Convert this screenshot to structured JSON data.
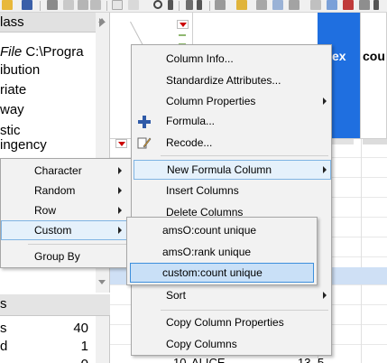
{
  "colors": {
    "accent": "#0078d7",
    "header_blue": "#1f6fe0",
    "menu_bg": "#f2f2f2",
    "highlight": "#e5f1fb",
    "highlight_strong": "#c9e0f7",
    "selected_row": "#cfe0f5",
    "red_triangle": "#cc0000"
  },
  "left_panel": {
    "header": "lass",
    "file_label": "File",
    "file_path": "C:\\Progra",
    "items": [
      "ibution",
      "riate",
      "way",
      "stic",
      "ingency"
    ]
  },
  "left_bottom": {
    "header": "s",
    "rows": [
      {
        "label": "s",
        "value": "40"
      },
      {
        "label": "d",
        "value": "1"
      },
      {
        "label": "",
        "value": "0"
      }
    ]
  },
  "grid": {
    "col_header_ex": "ex",
    "col_header_cou": "cou",
    "bottom_row_num": "10",
    "bottom_row_name": "ALICE",
    "bottom_row_val": "13",
    "bottom_row_val2": "5"
  },
  "context_menu": {
    "items": [
      {
        "label": "Column Info...",
        "icon": "",
        "submenu": false
      },
      {
        "label": "Standardize Attributes...",
        "icon": "",
        "submenu": false
      },
      {
        "label": "Column Properties",
        "icon": "",
        "submenu": true
      },
      {
        "label": "Formula...",
        "icon": "plus-icon",
        "submenu": false
      },
      {
        "label": "Recode...",
        "icon": "pencil-icon",
        "submenu": false
      },
      {
        "label": "New Formula Column",
        "icon": "",
        "submenu": true
      },
      {
        "label": "Insert Columns",
        "icon": "",
        "submenu": false
      },
      {
        "label": "Delete Columns",
        "icon": "",
        "submenu": false
      },
      {
        "label": "Sort",
        "icon": "",
        "submenu": true
      },
      {
        "label": "Copy Column Properties",
        "icon": "",
        "submenu": false
      },
      {
        "label": "Copy Columns",
        "icon": "",
        "submenu": false
      }
    ]
  },
  "category_menu": {
    "items": [
      {
        "label": "Character",
        "submenu": true
      },
      {
        "label": "Random",
        "submenu": true
      },
      {
        "label": "Row",
        "submenu": true
      },
      {
        "label": "Custom",
        "submenu": true
      },
      {
        "label": "Group By",
        "submenu": false
      }
    ]
  },
  "custom_menu": {
    "items": [
      {
        "label": "amsO:count unique"
      },
      {
        "label": "amsO:rank unique"
      },
      {
        "label": "custom:count unique"
      }
    ]
  }
}
